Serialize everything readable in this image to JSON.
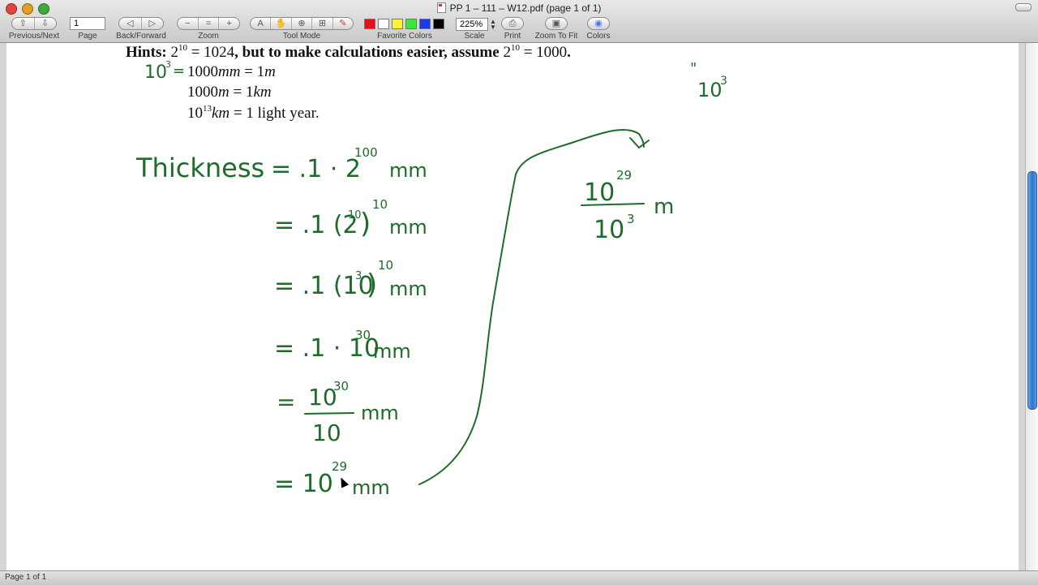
{
  "window": {
    "title": "PP 1 – 111 – W12.pdf (page 1 of 1)"
  },
  "toolbar": {
    "previous_next_label": "Previous/Next",
    "page_label": "Page",
    "page_value": "1",
    "back_forward_label": "Back/Forward",
    "zoom_label": "Zoom",
    "tool_mode_label": "Tool Mode",
    "favorite_colors_label": "Favorite Colors",
    "scale_label": "Scale",
    "scale_value": "225%",
    "print_label": "Print",
    "zoom_to_fit_label": "Zoom To Fit",
    "colors_label": "Colors",
    "favorite_colors": [
      "#e8101a",
      "#ffffff",
      "#fff23a",
      "#3ae83a",
      "#1a3ae8",
      "#000000"
    ]
  },
  "document": {
    "hints": {
      "prefix": "Hints:",
      "eq1_base": "2",
      "eq1_exp": "10",
      "eq1_rhs": "= 1024",
      "middle": ", but to make calculations easier, assume",
      "eq2_base": "2",
      "eq2_exp": "10",
      "eq2_rhs": "= 1000",
      "end": ".",
      "line2_lhs": "1000",
      "line2_unit": "mm",
      "line2_eq": " = 1",
      "line2_unit2": "m",
      "line3_lhs": "1000",
      "line3_unit": "m",
      "line3_eq": " = 1",
      "line3_unit2": "km",
      "line4_base": "10",
      "line4_exp": "13",
      "line4_unit": "km",
      "line4_rhs": " = 1 light year."
    },
    "ink": {
      "annot_left_base": "10",
      "annot_left_exp": "3",
      "annot_left_eq": "=",
      "annot_right_mark": "\"",
      "annot_right_base": "10",
      "annot_right_exp": "3",
      "thickness_word": "Thickness",
      "step1": "= .1 · 2",
      "step1_exp": "100",
      "step1_unit": "mm",
      "step2": "= .1 (2",
      "step2_inner_exp": "10",
      "step2_close": ")",
      "step2_exp": "10",
      "step2_unit": "mm",
      "step3": "= .1 (10",
      "step3_inner_exp": "3",
      "step3_close": ")",
      "step3_exp": "10",
      "step3_unit": "mm",
      "step4": "= .1 · 10",
      "step4_exp": "30",
      "step4_unit": "mm",
      "step5_eq": "=",
      "step5_num": "10",
      "step5_num_exp": "30",
      "step5_den": "10",
      "step5_unit": "mm",
      "step6": "= 10",
      "step6_exp": "29",
      "step6_unit": "mm",
      "conv_num": "10",
      "conv_num_exp": "29",
      "conv_den": "10",
      "conv_den_exp": "3",
      "conv_unit": "m"
    }
  },
  "status": {
    "text": "Page 1 of 1"
  }
}
